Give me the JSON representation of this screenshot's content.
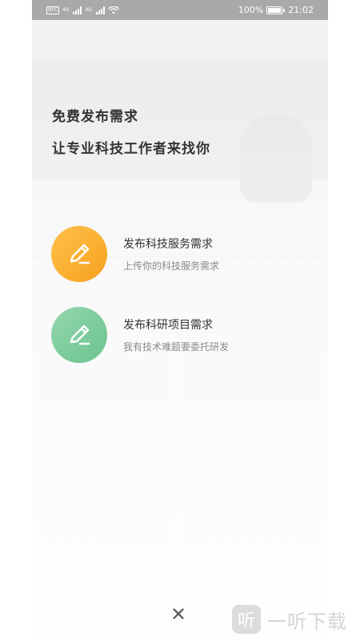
{
  "status_bar": {
    "sim1_tag": "4G",
    "sim2_tag": "4G",
    "nfc": "NFC",
    "battery_percent": "100%",
    "time": "21:02"
  },
  "modal": {
    "headline_line1": "免费发布需求",
    "headline_line2": "让专业科技工作者来找你",
    "options": [
      {
        "title": "发布科技服务需求",
        "subtitle": "上传你的科技服务需求",
        "icon": "pencil-icon",
        "color": "#f7a623"
      },
      {
        "title": "发布科研项目需求",
        "subtitle": "我有技术难题要委托研发",
        "icon": "pencil-icon",
        "color": "#79c99a"
      }
    ],
    "close_icon": "close-icon"
  },
  "watermark": {
    "logo_char": "听",
    "text": "一听下载"
  }
}
